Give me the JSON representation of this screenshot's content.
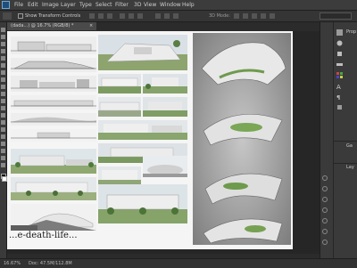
{
  "menubar": {
    "items": [
      "File",
      "Edit",
      "Image",
      "Layer",
      "Type",
      "Select",
      "Filter",
      "3D",
      "View",
      "Window",
      "Help"
    ]
  },
  "optionsbar": {
    "show_transform_controls": "Show Transform Controls",
    "mode_label": "3D Mode:"
  },
  "document": {
    "tab_title": "(dada...) @ 16.7% (RGB/8) *",
    "close": "×"
  },
  "sheet": {
    "title": "...e-death-life..."
  },
  "rightpanel": {
    "labels": [
      "Prop",
      "Ga",
      "Lay"
    ]
  },
  "status": {
    "zoom": "16.67%",
    "doc": "Doc: 47.5M/112.8M"
  },
  "colors": {
    "accent": "#1f4f78",
    "panel": "#3a3a3a",
    "workspace": "#262626"
  }
}
